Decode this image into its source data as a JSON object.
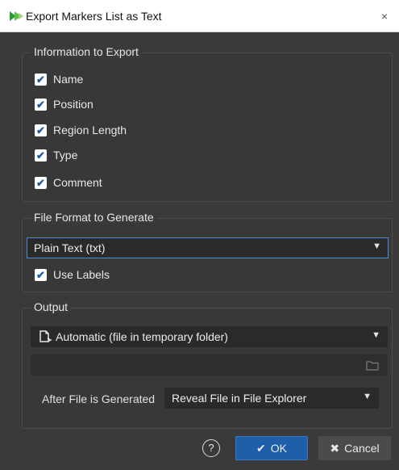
{
  "window": {
    "title": "Export Markers List as Text",
    "close_symbol": "×"
  },
  "info_group": {
    "legend": "Information to Export",
    "items": [
      {
        "label": "Name",
        "checked": true
      },
      {
        "label": "Position",
        "checked": true
      },
      {
        "label": "Region Length",
        "checked": true
      },
      {
        "label": "Type",
        "checked": true
      },
      {
        "label": "Comment",
        "checked": true
      }
    ]
  },
  "format_group": {
    "legend": "File Format to Generate",
    "format_value": "Plain Text (txt)",
    "use_labels": {
      "label": "Use Labels",
      "checked": true
    }
  },
  "output_group": {
    "legend": "Output",
    "destination_value": "Automatic (file in temporary folder)",
    "path_value": "",
    "after_label": "After File is Generated",
    "after_value": "Reveal File in File Explorer"
  },
  "footer": {
    "help_symbol": "?",
    "ok_label": "OK",
    "cancel_label": "Cancel"
  },
  "colors": {
    "accent": "#1f5ea9",
    "focus": "#4a8fd6",
    "background": "#3a3a3a"
  }
}
